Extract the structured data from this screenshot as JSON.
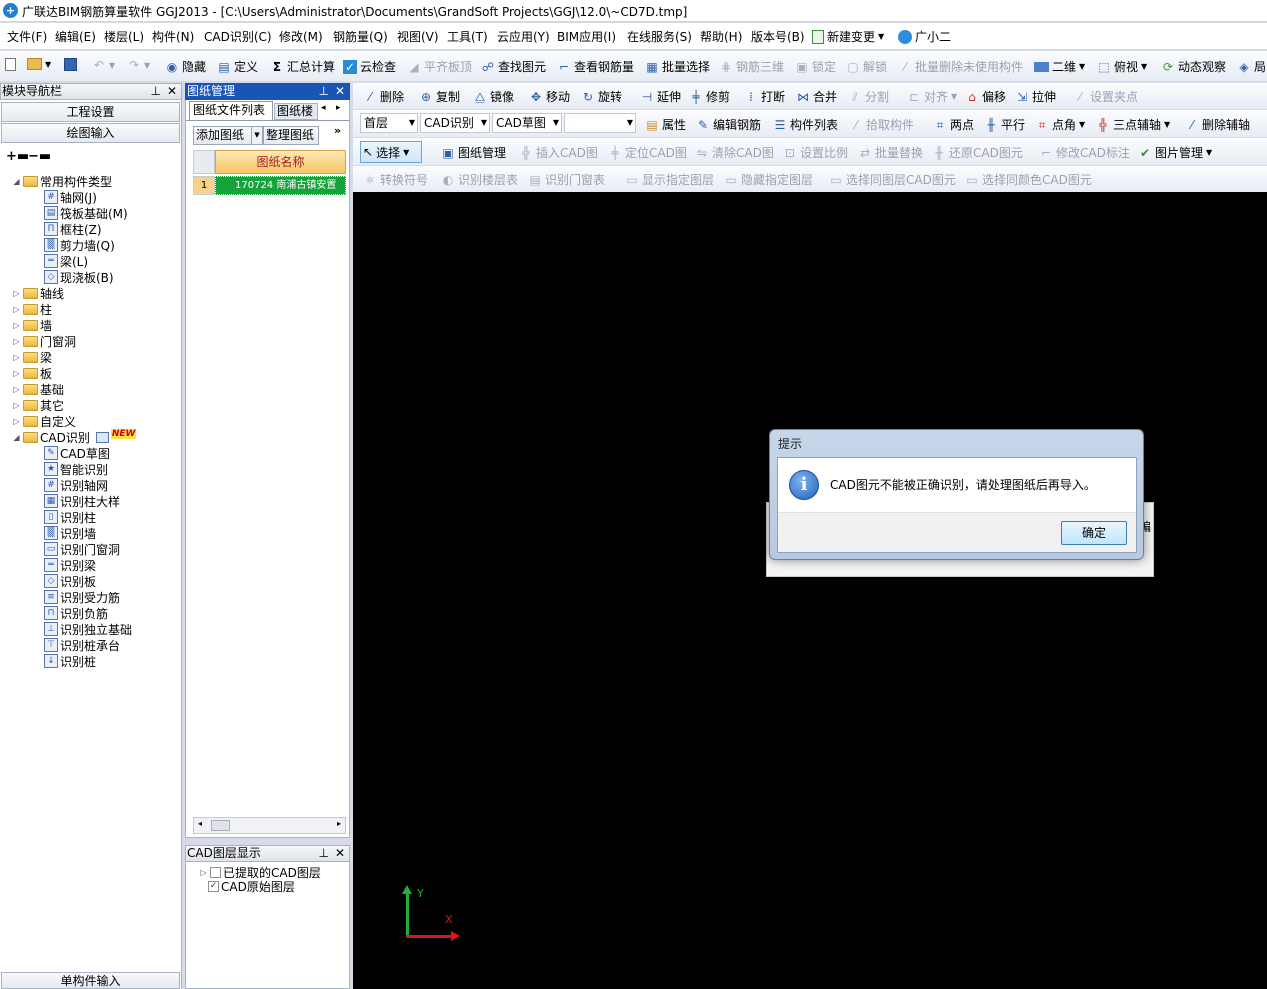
{
  "window": {
    "title": "广联达BIM钢筋算量软件 GGJ2013 - [C:\\Users\\Administrator\\Documents\\GrandSoft Projects\\GGJ\\12.0\\~CD7D.tmp]"
  },
  "menu": [
    "文件(F)",
    "编辑(E)",
    "楼层(L)",
    "构件(N)",
    "CAD识别(C)",
    "修改(M)",
    "钢筋量(Q)",
    "视图(V)",
    "工具(T)",
    "云应用(Y)",
    "BIM应用(I)",
    "在线服务(S)",
    "帮助(H)",
    "版本号(B)",
    "新建变更",
    "广小二"
  ],
  "toolbar1": [
    "隐藏",
    "定义",
    "汇总计算",
    "云检查",
    "平齐板顶",
    "查找图元",
    "查看钢筋量",
    "批量选择",
    "钢筋三维",
    "锁定",
    "解锁",
    "批量删除未使用构件",
    "二维",
    "俯视",
    "动态观察",
    "局"
  ],
  "toolbar2": [
    "删除",
    "复制",
    "镜像",
    "移动",
    "旋转",
    "延伸",
    "修剪",
    "打断",
    "合并",
    "分割",
    "对齐",
    "偏移",
    "拉伸",
    "设置夹点"
  ],
  "toolbar3": {
    "floor": "首层",
    "category": "CAD识别",
    "type": "CAD草图",
    "buttons": [
      "属性",
      "编辑钢筋",
      "构件列表",
      "拾取构件",
      "两点",
      "平行",
      "点角",
      "三点辅轴",
      "删除辅轴"
    ]
  },
  "toolbar4": {
    "select": "选择",
    "buttons": [
      "图纸管理",
      "插入CAD图",
      "定位CAD图",
      "清除CAD图",
      "设置比例",
      "批量替换",
      "还原CAD图元",
      "修改CAD标注",
      "图片管理"
    ]
  },
  "toolbar5": [
    "转换符号",
    "识别楼层表",
    "识别门窗表",
    "显示指定图层",
    "隐藏指定图层",
    "选择同图层CAD图元",
    "选择同颜色CAD图元"
  ],
  "nav": {
    "header": "模块导航栏",
    "setup_button": "工程设置",
    "drawing_button": "绘图输入",
    "bottom_button": "单构件输入",
    "tree": {
      "common": "常用构件类型",
      "common_children": [
        "轴网(J)",
        "筏板基础(M)",
        "框柱(Z)",
        "剪力墙(Q)",
        "梁(L)",
        "现浇板(B)"
      ],
      "folders": [
        "轴线",
        "柱",
        "墙",
        "门窗洞",
        "梁",
        "板",
        "基础",
        "其它",
        "自定义"
      ],
      "cad": "CAD识别",
      "cad_badge": "NEW",
      "cad_children": [
        "CAD草图",
        "智能识别",
        "识别轴网",
        "识别柱大样",
        "识别柱",
        "识别墙",
        "识别门窗洞",
        "识别梁",
        "识别板",
        "识别受力筋",
        "识别负筋",
        "识别独立基础",
        "识别桩承台",
        "识别桩"
      ]
    }
  },
  "drawings": {
    "header": "图纸管理",
    "tabs": [
      "图纸文件列表",
      "图纸楼"
    ],
    "add_button": "添加图纸",
    "organize_button": "整理图纸",
    "column_header": "图纸名称",
    "rows": [
      {
        "num": "1",
        "name": "170724 南浦古镇安置"
      }
    ]
  },
  "layers": {
    "header": "CAD图层显示",
    "items": [
      {
        "label": "已提取的CAD图层",
        "checked": false
      },
      {
        "label": "CAD原始图层",
        "checked": true
      }
    ]
  },
  "dialog": {
    "title": "提示",
    "message": "CAD图元不能被正确识别，请处理图纸后再导入。",
    "ok": "确定",
    "behind_text": "编"
  },
  "axis": {
    "x": "X",
    "y": "Y"
  }
}
